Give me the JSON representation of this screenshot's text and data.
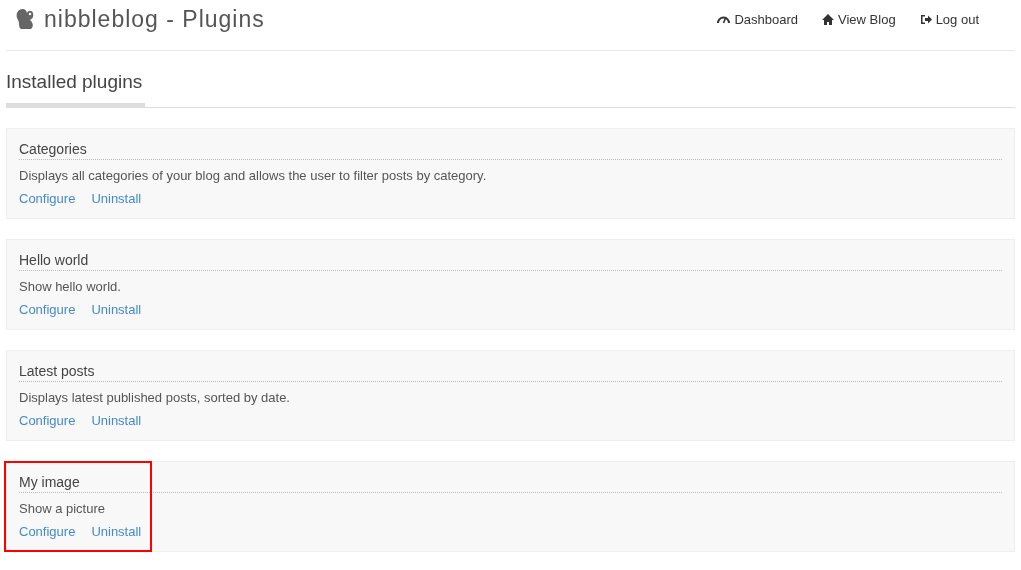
{
  "header": {
    "title": "nibbleblog - Plugins",
    "nav": [
      {
        "kind": "dashboard",
        "label": "Dashboard"
      },
      {
        "kind": "home",
        "label": "View Blog"
      },
      {
        "kind": "logout",
        "label": "Log out"
      }
    ]
  },
  "section_title": "Installed plugins",
  "plugins": [
    {
      "name": "Categories",
      "description": "Displays all categories of your blog and allows the user to filter posts by category.",
      "actions": [
        "Configure",
        "Uninstall"
      ],
      "highlighted": false
    },
    {
      "name": "Hello world",
      "description": "Show hello world.",
      "actions": [
        "Configure",
        "Uninstall"
      ],
      "highlighted": false
    },
    {
      "name": "Latest posts",
      "description": "Displays latest published posts, sorted by date.",
      "actions": [
        "Configure",
        "Uninstall"
      ],
      "highlighted": false
    },
    {
      "name": "My image",
      "description": "Show a picture",
      "actions": [
        "Configure",
        "Uninstall"
      ],
      "highlighted": true
    }
  ]
}
